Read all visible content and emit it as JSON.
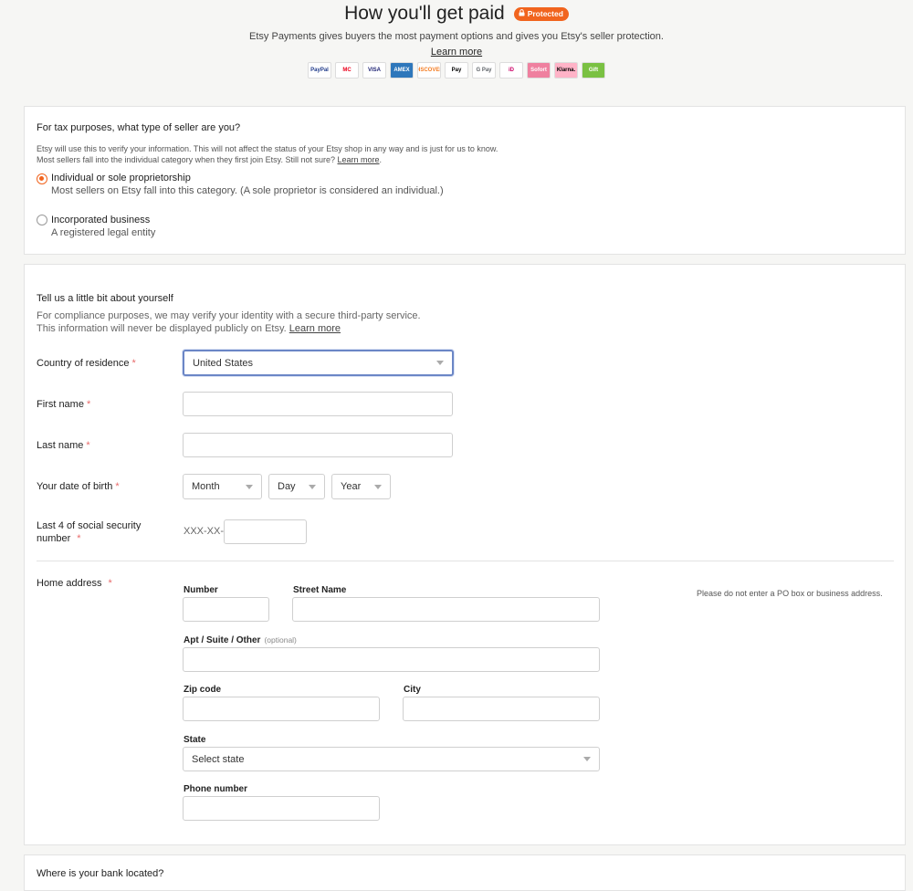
{
  "header": {
    "title": "How you'll get paid",
    "badge": "Protected",
    "subtitle": "Etsy Payments gives buyers the most payment options and gives you Etsy's seller protection.",
    "learn_more": "Learn more",
    "payment_methods": [
      {
        "label": "PayPal",
        "color": "#1f3a8a"
      },
      {
        "label": "MC",
        "color": "#eb001b"
      },
      {
        "label": "VISA",
        "color": "#1a1f71"
      },
      {
        "label": "AMEX",
        "color": "#2e77bb"
      },
      {
        "label": "DISCOVER",
        "color": "#f47b20"
      },
      {
        "label": "Pay",
        "color": "#000000"
      },
      {
        "label": "G Pay",
        "color": "#5f6368"
      },
      {
        "label": "iD",
        "color": "#cc0066"
      },
      {
        "label": "Sofort",
        "color": "#ffffff"
      },
      {
        "label": "Klarna.",
        "color": "#000000"
      },
      {
        "label": "Gift",
        "color": "#ffffff"
      }
    ]
  },
  "seller_type": {
    "question": "For tax purposes, what type of seller are you?",
    "info_line1": "Etsy will use this to verify your information. This will not affect the status of your Etsy shop in any way and is just for us to know.",
    "info_line2": "Most sellers fall into the individual category when they first join Etsy. Still not sure?",
    "info_learn": "Learn more",
    "info_end": ".",
    "options": [
      {
        "label": "Individual or sole proprietorship",
        "desc": "Most sellers on Etsy fall into this category. (A sole proprietor is considered an individual.)",
        "selected": true
      },
      {
        "label": "Incorporated business",
        "desc": "A registered legal entity",
        "selected": false
      }
    ]
  },
  "about": {
    "title": "Tell us a little bit about yourself",
    "line1": "For compliance purposes, we may verify your identity with a secure third-party service.",
    "line2": "This information will never be displayed publicly on Etsy.",
    "learn": "Learn more",
    "country_label": "Country of residence",
    "country_value": "United States",
    "first_name_label": "First name",
    "first_name_value": "",
    "last_name_label": "Last name",
    "last_name_value": "",
    "dob_label": "Your date of birth",
    "dob_month": "Month",
    "dob_day": "Day",
    "dob_year": "Year",
    "ssn_label_line1": "Last 4 of social security",
    "ssn_label_line2": "number",
    "ssn_prefix": "XXX-XX-",
    "ssn_value": "",
    "required_mark": "*"
  },
  "address": {
    "label": "Home address",
    "number_label": "Number",
    "street_label": "Street Name",
    "apt_label": "Apt / Suite / Other",
    "optional": "(optional)",
    "zip_label": "Zip code",
    "city_label": "City",
    "state_label": "State",
    "state_value": "Select state",
    "phone_label": "Phone number",
    "hint": "Please do not enter a PO box or business address."
  },
  "bank": {
    "question": "Where is your bank located?"
  }
}
